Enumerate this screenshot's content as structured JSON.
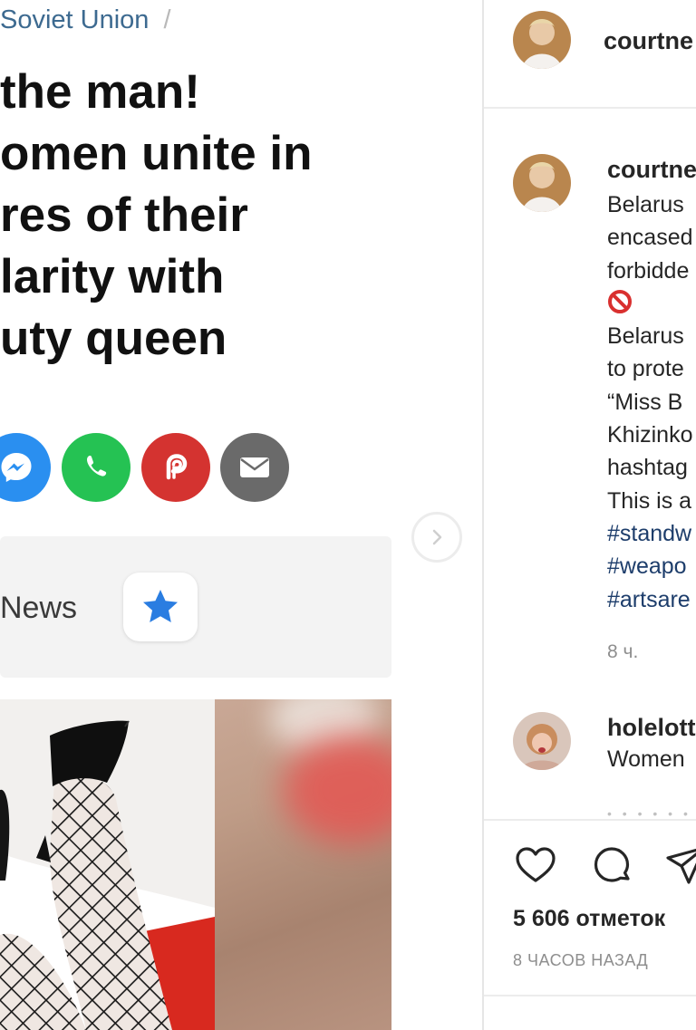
{
  "article": {
    "breadcrumb": "Soviet Union",
    "breadcrumb_sep": "/",
    "headline_lines": [
      "the man!",
      "omen unite in",
      "res of their",
      "larity with",
      "uty queen"
    ],
    "share_buttons": [
      {
        "name": "messenger",
        "icon": "messenger-icon",
        "color": "#2a8ff0"
      },
      {
        "name": "whatsapp",
        "icon": "whatsapp-icon",
        "color": "#25c253"
      },
      {
        "name": "parler",
        "icon": "parler-icon",
        "color": "#d43330"
      },
      {
        "name": "email",
        "icon": "envelope-icon",
        "color": "#6a6a6a"
      }
    ],
    "news_label": "News",
    "star_icon": "star-icon",
    "star_color": "#2a7de1"
  },
  "instagram": {
    "header_username": "courtne",
    "caption_username": "courtne",
    "caption_lines": [
      "Belarus",
      "encased",
      "forbidde",
      "",
      "Belarus",
      "to prote",
      "“Miss B",
      "Khizinko",
      "hashtag",
      "This is a"
    ],
    "hashtags": [
      "#standw",
      "#weapo",
      "#artsare"
    ],
    "caption_time": "8 ч.",
    "comment_username": "holelott",
    "comment_text": "Women",
    "likes": "5 606 отметок",
    "post_time": "8 ЧАСОВ НАЗАД",
    "hashtag_color": "#1d3d6b",
    "no_entry_color": "#d9302f"
  }
}
